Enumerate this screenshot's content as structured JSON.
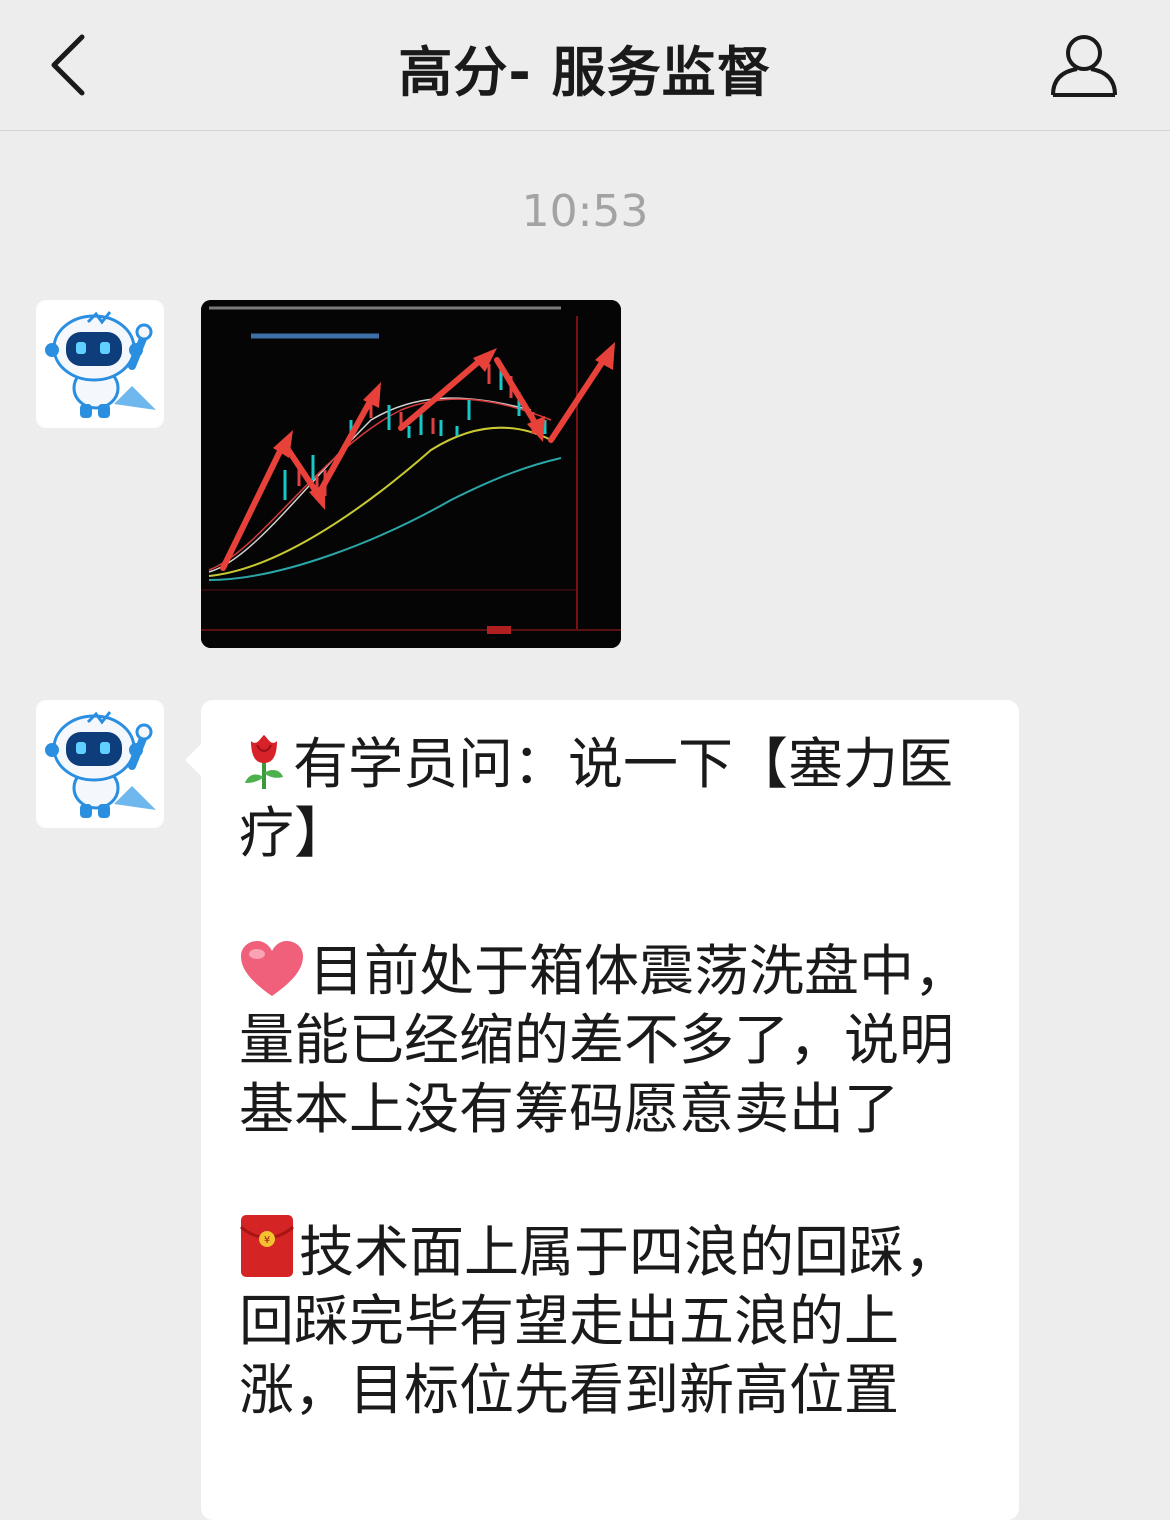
{
  "header": {
    "title": "高分- 服务监督",
    "back_icon": "chevron-left-icon",
    "profile_icon": "person-icon"
  },
  "chat": {
    "timestamp": "10:53",
    "messages": [
      {
        "type": "image",
        "sender_avatar": "robot-mascot",
        "image_description_icon": "stock-candlestick-chart-image"
      },
      {
        "type": "text",
        "sender_avatar": "robot-mascot",
        "paragraphs": [
          {
            "emoji": "rose-icon",
            "text": "有学员问：说一下【塞力医疗】"
          },
          {
            "emoji": "heart-icon",
            "text": "目前处于箱体震荡洗盘中，量能已经缩的差不多了，说明基本上没有筹码愿意卖出了"
          },
          {
            "emoji": "red-envelope-icon",
            "text": "技术面上属于四浪的回踩，回踩完毕有望走出五浪的上涨，目标位先看到新高位置"
          }
        ]
      }
    ]
  },
  "colors": {
    "background": "#ededed",
    "bubble": "#ffffff",
    "chart_bg": "#050505",
    "chart_arrow": "#e8413a",
    "mascot_blue": "#2a8fe0"
  }
}
